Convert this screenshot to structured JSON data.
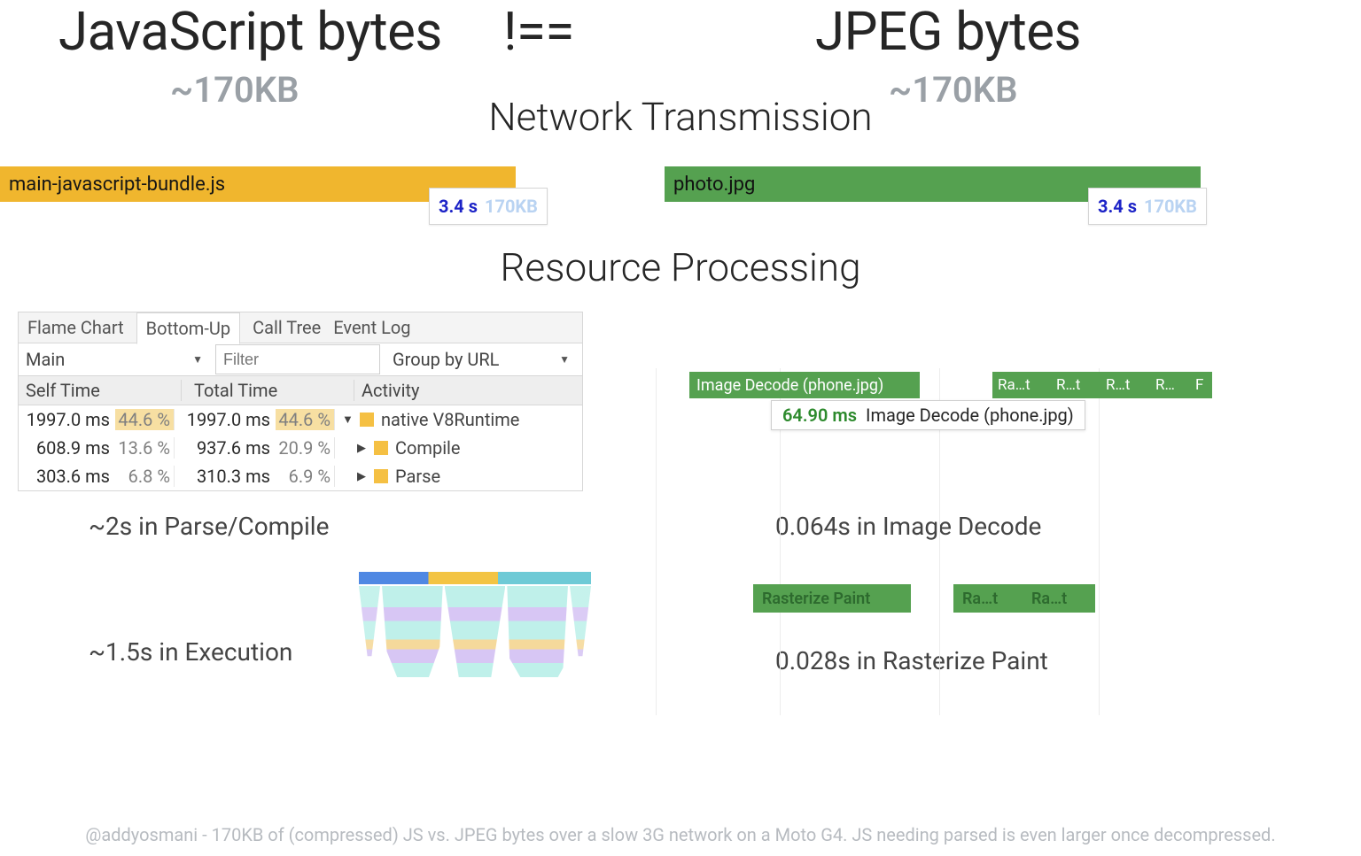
{
  "headline": {
    "left": "JavaScript bytes",
    "center": "!==",
    "right": "JPEG bytes",
    "approx_left": "~170KB",
    "approx_right": "~170KB"
  },
  "sections": {
    "network": "Network Transmission",
    "resource": "Resource Processing"
  },
  "network": {
    "js": {
      "label": "main-javascript-bundle.js",
      "time": "3.4 s",
      "size": "170KB"
    },
    "jpeg": {
      "label": "photo.jpg",
      "time": "3.4 s",
      "size": "170KB"
    }
  },
  "devtools": {
    "tabs": {
      "flame": "Flame Chart",
      "bottomup": "Bottom-Up",
      "calltree": "Call Tree",
      "eventlog": "Event Log"
    },
    "controls": {
      "main": "Main",
      "filter_placeholder": "Filter",
      "group": "Group by URL"
    },
    "headers": {
      "self": "Self Time",
      "total": "Total Time",
      "activity": "Activity"
    },
    "rows": [
      {
        "self_ms": "1997.0 ms",
        "self_pct": "44.6 %",
        "total_ms": "1997.0 ms",
        "total_pct": "44.6 %",
        "caret": "▼",
        "activity": "native V8Runtime"
      },
      {
        "self_ms": "608.9 ms",
        "self_pct": "13.6 %",
        "total_ms": "937.6 ms",
        "total_pct": "20.9 %",
        "caret": "▶",
        "activity": "Compile"
      },
      {
        "self_ms": "303.6 ms",
        "self_pct": "6.8 %",
        "total_ms": "310.3 ms",
        "total_pct": "6.9 %",
        "caret": "▶",
        "activity": "Parse"
      }
    ]
  },
  "decode": {
    "main": "Image Decode (phone.jpg)",
    "chips": [
      "Ra…t",
      "R…t",
      "R…t",
      "R…",
      "F"
    ],
    "tooltip_ms": "64.90 ms",
    "tooltip_label": "Image Decode (phone.jpg)"
  },
  "raster": {
    "chips": [
      "Rasterize Paint",
      "Ra…t",
      "Ra…t"
    ]
  },
  "metrics": {
    "parse": "~2s in Parse/Compile",
    "exec": "~1.5s in Execution",
    "decode": "0.064s in Image Decode",
    "raster": "0.028s in Rasterize Paint"
  },
  "credit": "@addyosmani - 170KB of (compressed) JS vs. JPEG bytes over a slow 3G network on a Moto G4. JS needing parsed is even larger once decompressed."
}
